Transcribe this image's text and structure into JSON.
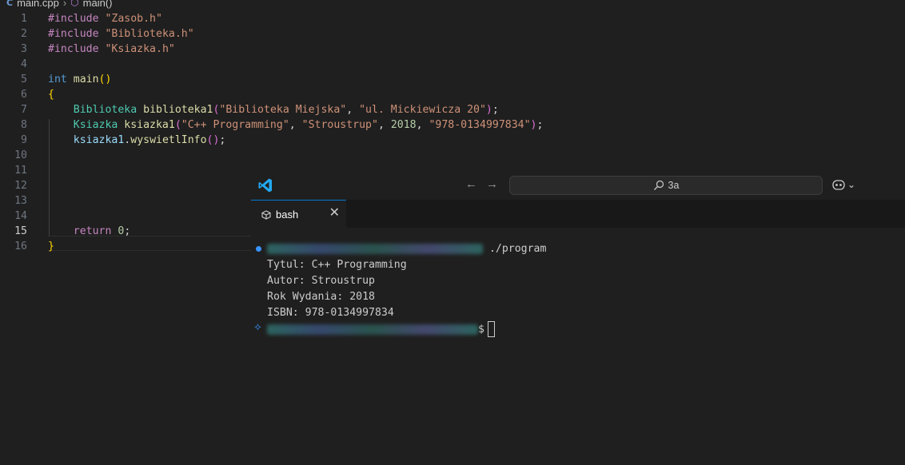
{
  "breadcrumb": {
    "file": "main.cpp",
    "symbol": "main()"
  },
  "editor": {
    "active_line": 15
  },
  "titlebar": {
    "search_text": "3a"
  },
  "tab": {
    "label": "bash"
  },
  "terminal": {
    "command": "./program",
    "output": [
      "Tytul: C++ Programming",
      "Autor: Stroustrup",
      "Rok Wydania: 2018",
      "ISBN: 978-0134997834"
    ],
    "prompt_suffix": "$"
  },
  "colors": {
    "accent": "#0078d4",
    "keyword": "#569cd6",
    "string": "#ce9178",
    "type": "#4ec9b0",
    "preprocessor": "#c586c0"
  }
}
